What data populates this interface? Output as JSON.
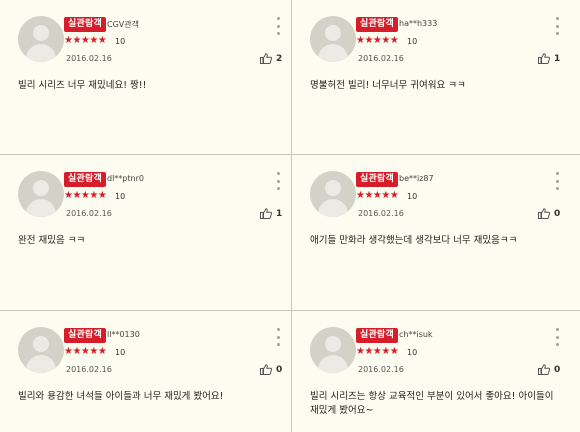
{
  "reviews": [
    {
      "badge": "실관람객",
      "user": "CGV관객",
      "stars": "★★★★★",
      "score": "10",
      "date": "2016.02.16",
      "likes": "2",
      "text": "빌리 시리즈 너무 재밌네요! 짱!!"
    },
    {
      "badge": "실관람객",
      "user": "ha**h333",
      "stars": "★★★★★",
      "score": "10",
      "date": "2016.02.16",
      "likes": "1",
      "text": "명불허전 빌리! 너무너무 귀여워요 ㅋㅋ"
    },
    {
      "badge": "실관람객",
      "user": "dl**ptnr0",
      "stars": "★★★★★",
      "score": "10",
      "date": "2016.02.16",
      "likes": "1",
      "text": "완전 재밌음 ㅋㅋ"
    },
    {
      "badge": "실관람객",
      "user": "be**iz87",
      "stars": "★★★★★",
      "score": "10",
      "date": "2016.02.16",
      "likes": "0",
      "text": "애기들 만화라 생각했는데 생각보다 너무 재밌음ㅋㅋ"
    },
    {
      "badge": "실관람객",
      "user": "ll**0130",
      "stars": "★★★★★",
      "score": "10",
      "date": "2016.02.16",
      "likes": "0",
      "text": "빌리와 용감한 녀석들 아이들과 너무 재밌게 봤어요!"
    },
    {
      "badge": "실관람객",
      "user": "ch**isuk",
      "stars": "★★★★★",
      "score": "10",
      "date": "2016.02.16",
      "likes": "0",
      "text": "빌리 시리즈는 항상 교육적인 부분이 있어서 좋아요! 아이들이 재밌게 봤어요~"
    }
  ],
  "colors": {
    "badge": "#d61e2a",
    "star": "#d61e2a",
    "background": "#fdfcf0"
  },
  "icons": {
    "avatar": "default-user-avatar",
    "more": "more-vertical-icon",
    "like": "thumbs-up-icon"
  }
}
